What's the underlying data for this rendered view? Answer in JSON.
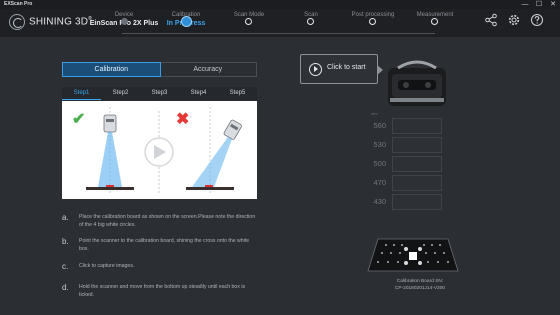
{
  "window": {
    "title": "EXScan Pro",
    "controls": {
      "minimize": "—",
      "maximize": "☐",
      "close": "✕"
    }
  },
  "brand": {
    "logo_text": "SHINING 3D",
    "logo_registered": "®"
  },
  "workflow": [
    {
      "label": "Device",
      "value": "EinScan Pro 2X Plus",
      "state": "done"
    },
    {
      "label": "Calibration",
      "value": "In Progress",
      "state": "current"
    },
    {
      "label": "Scan Mode",
      "value": "-",
      "state": "todo"
    },
    {
      "label": "Scan",
      "value": "-",
      "state": "todo"
    },
    {
      "label": "Post processing",
      "value": "-",
      "state": "todo"
    },
    {
      "label": "Measurement",
      "value": "-",
      "state": "todo"
    }
  ],
  "header_icons": [
    "share-icon",
    "settings-icon",
    "help-icon"
  ],
  "tabs": [
    {
      "label": "Calibration",
      "active": true
    },
    {
      "label": "Accuracy",
      "active": false
    }
  ],
  "steps": [
    {
      "label": "Step1",
      "active": true
    },
    {
      "label": "Step2",
      "active": false
    },
    {
      "label": "Step3",
      "active": false
    },
    {
      "label": "Step4",
      "active": false
    },
    {
      "label": "Step5",
      "active": false
    }
  ],
  "illustration": {
    "correct_mark": "✔",
    "wrong_mark": "✖"
  },
  "instructions": [
    {
      "letter": "a.",
      "text": "Place the calibration board as shown on the screen.Please note the direction of the 4 big white circles."
    },
    {
      "letter": "b.",
      "text": "Point the scanner to the calibration board, shining the cross onto the white box."
    },
    {
      "letter": "c.",
      "text": "Click to capture images."
    },
    {
      "letter": "d.",
      "text": "Hold the scanner and move from the bottom up steadily until each box is ticked."
    }
  ],
  "start_button": {
    "label": "Click to start"
  },
  "distance": {
    "unit": "mm",
    "levels": [
      "560",
      "530",
      "500",
      "470",
      "430"
    ]
  },
  "calibration_board": {
    "line1": "Calibration Board SN:",
    "line2": "CP-20180201J14-V300"
  },
  "colors": {
    "accent": "#3aa6f0",
    "background": "#2b2e33",
    "header": "#1e2023",
    "check_green": "#4caf50",
    "cross_red": "#e53935"
  }
}
